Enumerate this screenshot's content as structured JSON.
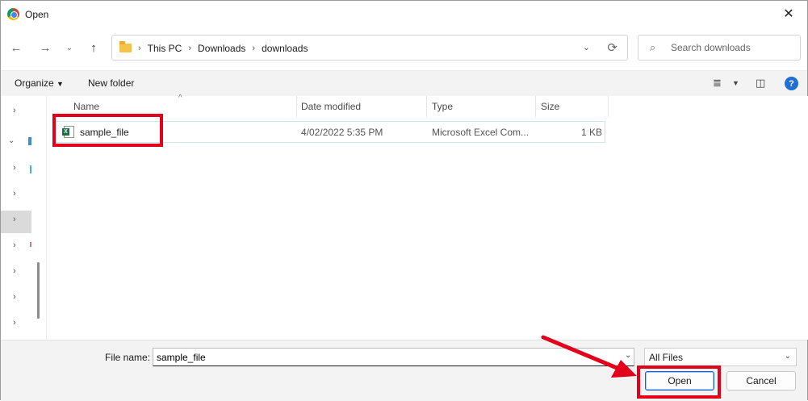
{
  "window": {
    "title": "Open"
  },
  "addressbar": {
    "crumbs": [
      "This PC",
      "Downloads",
      "downloads"
    ]
  },
  "search": {
    "placeholder": "Search downloads"
  },
  "toolbar": {
    "organize_label": "Organize",
    "new_folder_label": "New folder"
  },
  "columns": {
    "name": "Name",
    "date": "Date modified",
    "type": "Type",
    "size": "Size"
  },
  "files": [
    {
      "name": "sample_file",
      "date": "4/02/2022 5:35 PM",
      "type": "Microsoft Excel Com...",
      "size": "1 KB",
      "icon": "excel-file-icon"
    }
  ],
  "footer": {
    "filename_label": "File name:",
    "filename_value": "sample_file",
    "filter_value": "All Files",
    "open_label": "Open",
    "cancel_label": "Cancel"
  },
  "colors": {
    "annotation": "#e3001b",
    "accent": "#1f6fd6"
  }
}
